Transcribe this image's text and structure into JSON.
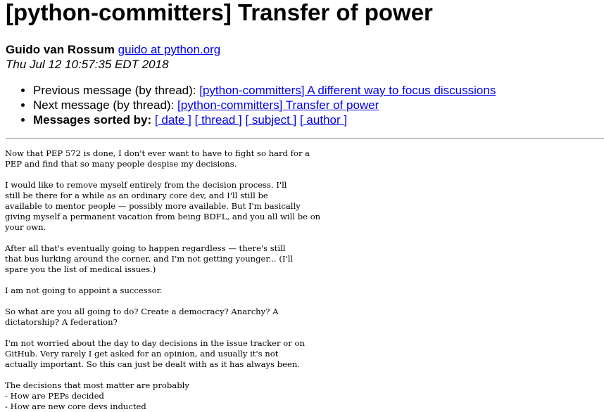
{
  "page_title": "[python-committers] Transfer of power",
  "author": {
    "name": "Guido van Rossum",
    "email_link": "guido at python.org "
  },
  "date": "Thu Jul 12 10:57:35 EDT 2018",
  "navigation": {
    "previous_label": "Previous message (by thread): ",
    "previous_link": "[python-committers] A different way to focus discussions",
    "next_label": "Next message (by thread): ",
    "next_link": "[python-committers] Transfer of power",
    "sorted_label": "Messages sorted by:",
    "sort_links": [
      "[ date ]",
      "[ thread ]",
      "[ subject ]",
      "[ author ]"
    ]
  },
  "message_body": "Now that PEP 572 is done, I don't ever want to have to fight so hard for a\nPEP and find that so many people despise my decisions.\n\nI would like to remove myself entirely from the decision process. I'll\nstill be there for a while as an ordinary core dev, and I'll still be\navailable to mentor people — possibly more available. But I'm basically\ngiving myself a permanent vacation from being BDFL, and you all will be on\nyour own.\n\nAfter all that's eventually going to happen regardless — there's still\nthat bus lurking around the corner, and I'm not getting younger... (I'll\nspare you the list of medical issues.)\n\nI am not going to appoint a successor.\n\nSo what are you all going to do? Create a democracy? Anarchy? A\ndictatorship? A federation?\n\nI'm not worried about the day to day decisions in the issue tracker or on\nGitHub. Very rarely I get asked for an opinion, and usually it's not\nactually important. So this can just be dealt with as it has always been.\n\nThe decisions that most matter are probably\n- How are PEPs decided\n- How are new core devs inducted"
}
